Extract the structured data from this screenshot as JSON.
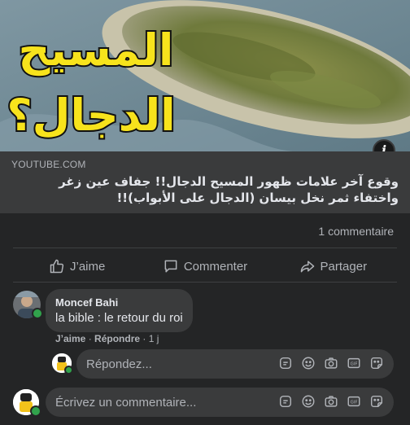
{
  "post": {
    "domain": "YOUTUBE.COM",
    "title": "وقوع آخر علامات ظهور المسيح الدجال!! جفاف عين زغر واختفاء ثمر نخل بيسان (الدجال على الأبواب)!!",
    "thumbnail_text_line1": "المسيح",
    "thumbnail_text_line2": "الدجال؟",
    "comment_count": "1 commentaire"
  },
  "actions": {
    "like": "J’aime",
    "comment": "Commenter",
    "share": "Partager"
  },
  "comment": {
    "author": "Moncef Bahi",
    "text": "la bible : le retour du roi",
    "like_link": "J’aime",
    "reply_link": "Répondre",
    "time": "1 j"
  },
  "reply_input": {
    "placeholder": "Répondez..."
  },
  "comment_input": {
    "placeholder": "Écrivez un commentaire..."
  },
  "icons": {
    "info": "info-icon",
    "like": "thumbs-up-icon",
    "comment": "speech-bubble-icon",
    "share": "share-arrow-icon",
    "tools": [
      "sticker-icon",
      "emoji-icon",
      "camera-icon",
      "gif-icon",
      "sticker-face-icon"
    ]
  },
  "colors": {
    "online": "#31a24c",
    "thumb_text": "#f7e31c"
  }
}
